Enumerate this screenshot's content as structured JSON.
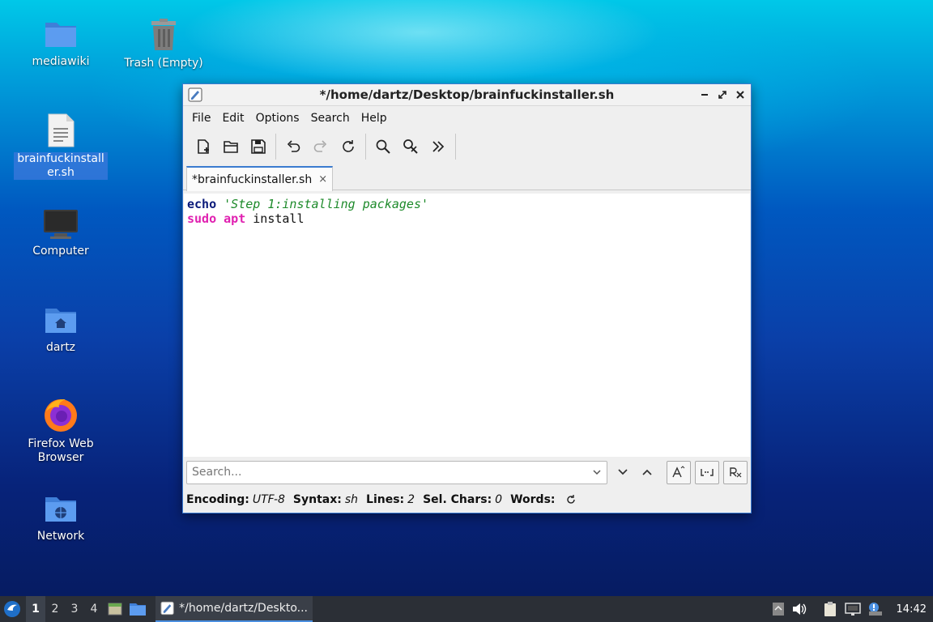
{
  "desktop": {
    "icons": [
      {
        "label": "mediawiki"
      },
      {
        "label": "Trash (Empty)"
      },
      {
        "label": "brainfuckinstaller.sh"
      },
      {
        "label": "Computer"
      },
      {
        "label": "dartz"
      },
      {
        "label": "Firefox Web Browser"
      },
      {
        "label": "Network"
      }
    ]
  },
  "window": {
    "title": "*/home/dartz/Desktop/brainfuckinstaller.sh",
    "menu": [
      "File",
      "Edit",
      "Options",
      "Search",
      "Help"
    ],
    "tab": {
      "label": "*brainfuckinstaller.sh",
      "close": "×"
    },
    "code": {
      "line1": {
        "keyword": "echo",
        "string": "'Step 1:installing packages'"
      },
      "line2": {
        "keyword1": "sudo",
        "keyword2": "apt",
        "text": "install"
      }
    },
    "search": {
      "placeholder": "Search..."
    },
    "status": {
      "encoding_label": "Encoding:",
      "encoding_value": "UTF-8",
      "syntax_label": "Syntax:",
      "syntax_value": "sh",
      "lines_label": "Lines:",
      "lines_value": "2",
      "selchars_label": "Sel. Chars:",
      "selchars_value": "0",
      "words_label": "Words:"
    }
  },
  "taskbar": {
    "workspaces": [
      "1",
      "2",
      "3",
      "4"
    ],
    "task_label": "*/home/dartz/Deskto...",
    "clock": "14:42"
  },
  "colors": {
    "accent": "#3a7bd0",
    "keyword_sudo": "#e020b0",
    "string": "#1d8a2a",
    "keyword_echo": "#0a1a7a"
  }
}
